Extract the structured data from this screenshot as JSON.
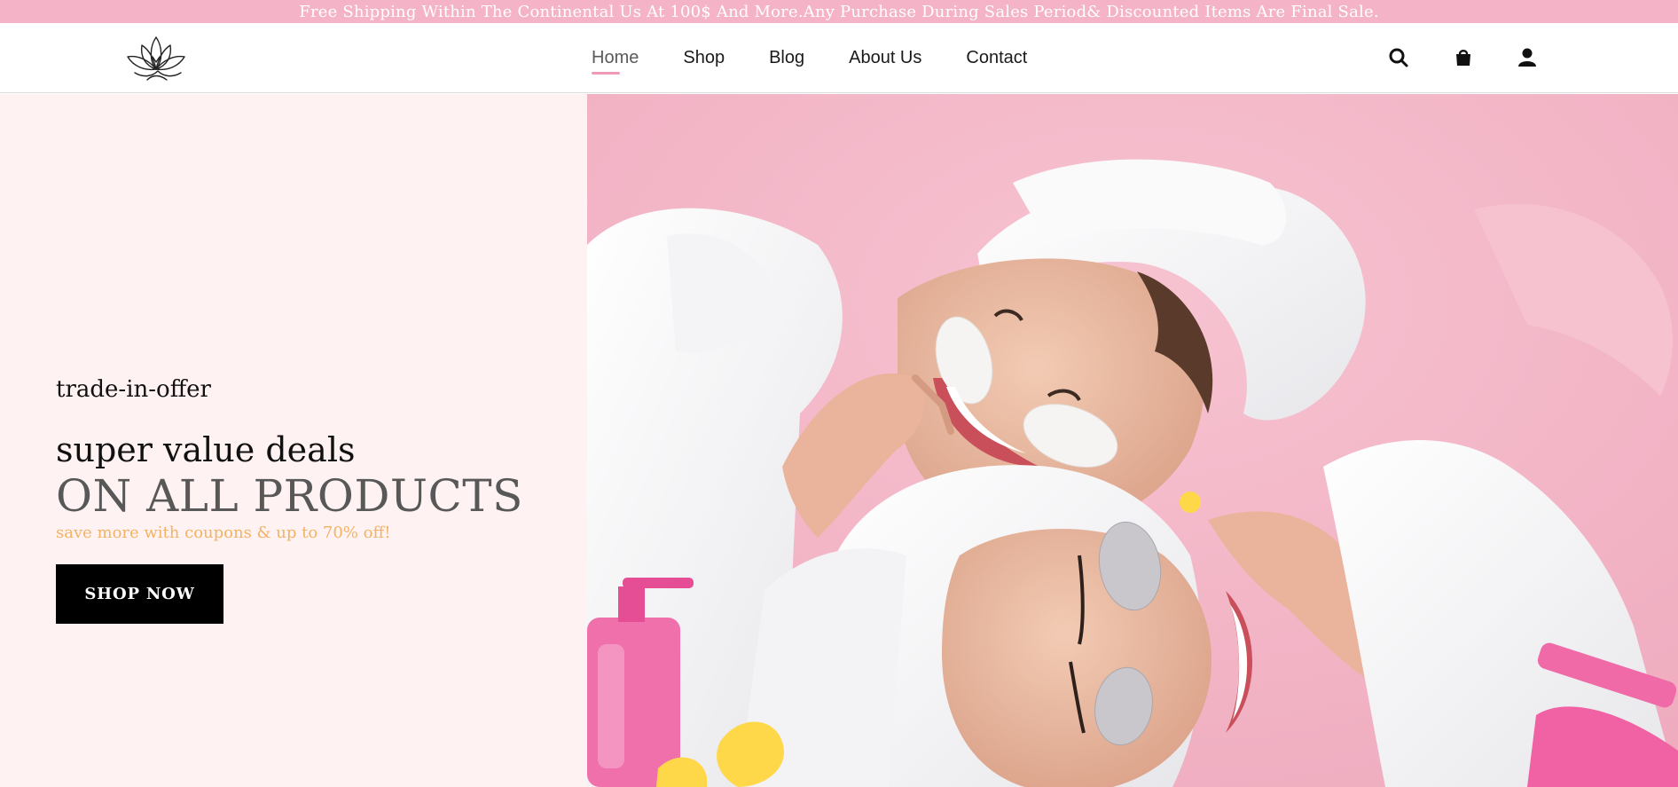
{
  "announcement": "Free Shipping Within The Continental Us At 100$ And More.Any Purchase During Sales Period& Discounted Items Are Final Sale.",
  "nav": {
    "items": [
      {
        "label": "Home",
        "active": true
      },
      {
        "label": "Shop",
        "active": false
      },
      {
        "label": "Blog",
        "active": false
      },
      {
        "label": "About Us",
        "active": false
      },
      {
        "label": "Contact",
        "active": false
      }
    ]
  },
  "header_icons": [
    "search-icon",
    "shopping-bag-icon",
    "user-icon"
  ],
  "hero": {
    "kicker": "trade-in-offer",
    "headline": "super value deals",
    "headline2": "ON ALL PRODUCTS",
    "subtext": "save more with coupons & up to 70% off!",
    "button_label": "SHOP NOW"
  },
  "colors": {
    "announcement_bg": "#f4b3c6",
    "hero_left_bg": "#fff2f2",
    "nav_underline": "#f09ab6",
    "subtext": "#f2b366",
    "button_bg": "#000000",
    "image_bg": "#f3b3c4"
  }
}
